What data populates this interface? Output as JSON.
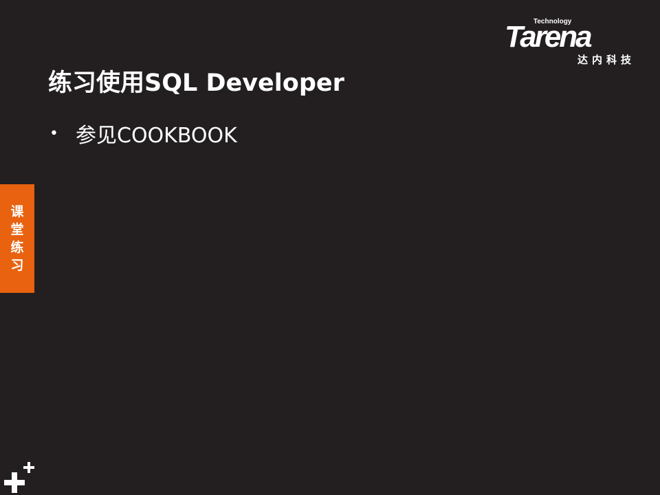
{
  "logo": {
    "small_text": "Technology",
    "main_text": "Tarena",
    "cn_text": "达内科技",
    "icon": "tarena-logo"
  },
  "slide": {
    "title": "练习使用SQL Developer",
    "bullets": [
      {
        "marker": "•",
        "text": "参见COOKBOOK"
      }
    ]
  },
  "side_tab": {
    "label": "课堂练习",
    "color": "#e8620f"
  },
  "corner_icon": "plus-icon",
  "colors": {
    "background": "#231f20",
    "text": "#ffffff",
    "accent": "#e8620f"
  }
}
